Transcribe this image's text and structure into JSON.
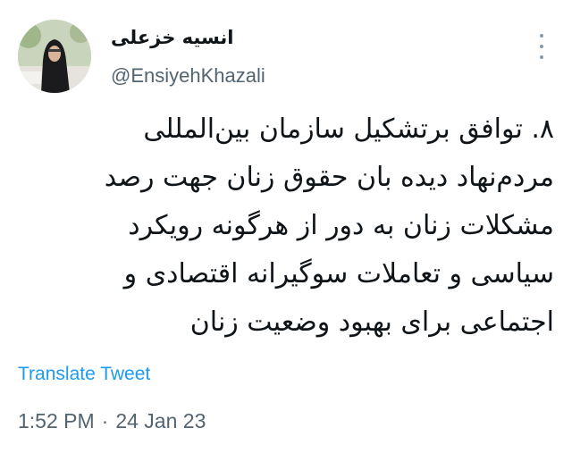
{
  "author": {
    "display_name": "انسیه خزعلی",
    "handle": "@EnsiyehKhazali"
  },
  "tweet": {
    "lines": [
      "۸. توافق برتشکیل سازمان بین‌المللی",
      "مردم‌نهاد دیده بان حقوق زنان جهت رصد",
      "مشکلات زنان به دور از هرگونه رویکرد",
      "سیاسی و تعاملات سوگیرانه اقتصادی و",
      "اجتماعی برای بهبود وضعیت زنان"
    ],
    "translate_label": "Translate Tweet",
    "time": "1:52 PM",
    "separator": "·",
    "date": "24 Jan 23"
  },
  "icons": {
    "more": "more-options-icon",
    "avatar": "profile-photo"
  },
  "colors": {
    "link": "#1d9bf0",
    "secondary_text": "#536471",
    "primary_text": "#0f1419"
  }
}
